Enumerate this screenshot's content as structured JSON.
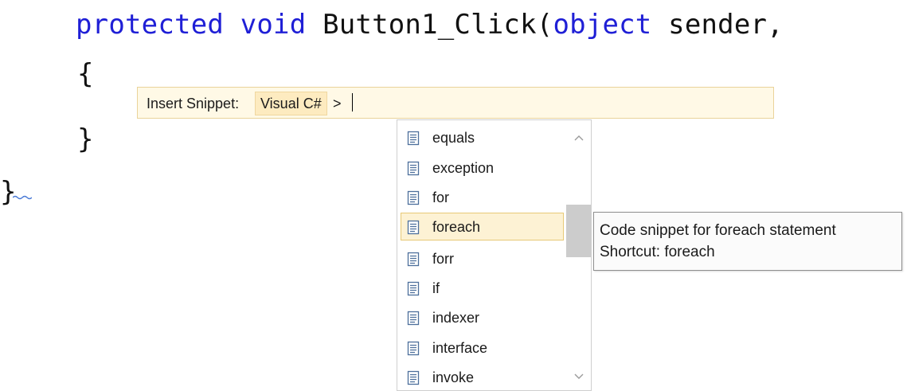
{
  "editor": {
    "code_lines": {
      "method_signature": {
        "keyword1": "protected",
        "keyword2": "void",
        "method_name": "Button1_Click(",
        "param_type": "object",
        "param_rest": "sender,"
      },
      "open_brace": "{",
      "close_brace": "}",
      "outer_close_brace": "}"
    }
  },
  "insert_snippet": {
    "label": "Insert Snippet:",
    "path": "Visual C#",
    "separator": ">"
  },
  "completion_list": {
    "items": [
      {
        "label": "equals",
        "icon": "snippet-icon"
      },
      {
        "label": "exception",
        "icon": "snippet-icon"
      },
      {
        "label": "for",
        "icon": "snippet-icon"
      },
      {
        "label": "foreach",
        "icon": "snippet-icon",
        "selected": true
      },
      {
        "label": "forr",
        "icon": "snippet-icon"
      },
      {
        "label": "if",
        "icon": "snippet-icon"
      },
      {
        "label": "indexer",
        "icon": "snippet-icon"
      },
      {
        "label": "interface",
        "icon": "snippet-icon"
      },
      {
        "label": "invoke",
        "icon": "snippet-icon"
      }
    ],
    "selected_index": 3
  },
  "tooltip": {
    "description": "Code snippet for foreach statement",
    "shortcut": "Shortcut: foreach"
  },
  "colors": {
    "keyword": "#1f1fd6",
    "snippet_bar_bg": "#fff9e6",
    "selected_item_bg": "#fdf2d4",
    "squiggle": "#4a7ad6"
  }
}
